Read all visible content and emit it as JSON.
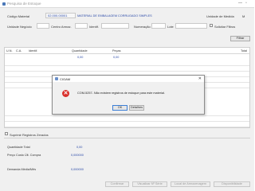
{
  "window": {
    "title": "Pesquisa de Estoque",
    "min_glyph": "—",
    "max_glyph": "▫"
  },
  "header": {
    "codigo_label": "Código Material",
    "codigo_value": "02.000.00001",
    "codigo_desc": "MATERIAL DE EMBALAGEM CORRUGADO SIMPLES",
    "unidade_medida_label": "Unidade de Medida",
    "unidade_medida_value": "M",
    "unidade_negocio_label": "Unidade Negócio",
    "centro_label": "Centro Armaz.",
    "identif_label": "Identif.",
    "numeracao_label": "Numeração",
    "lote_label": "Lote",
    "solicitar_filtros_label": "Solicitar Filtros",
    "filtrar_label": "Filtrar"
  },
  "grid": {
    "columns": [
      "U.N.",
      "C.A.",
      "Identif.",
      "Quantidade",
      "Peças",
      "Total"
    ],
    "quantidade_total": "0,00",
    "pecas_total": "0,00"
  },
  "suprimir": {
    "label": "Suprimir Registros Zerados"
  },
  "summary": {
    "quantidade_total_label": "Quantidade Total",
    "quantidade_total_value": "0,00",
    "preco_custo_label": "Preço Custo Últ. Compra",
    "preco_custo_value": "0,000000",
    "demanda_label": "Demanda Média/Mês",
    "demanda_value": "0,000000"
  },
  "footer_buttons": {
    "confirmar": "Confirmar",
    "visualizar": "Visualizar Nº Série",
    "local": "Local de Armazenagem",
    "disponibilidade": "Disponibilidade"
  },
  "dialog": {
    "title": "CIGAM",
    "message": "COM-5257- Não existem registros de estoque para este material.",
    "ok_label": "OK",
    "detalhes_label": "Detalhes",
    "error_glyph": "✕",
    "close_glyph": "✕"
  },
  "colors": {
    "accent": "#2b4aa8",
    "error": "#d9302c"
  }
}
